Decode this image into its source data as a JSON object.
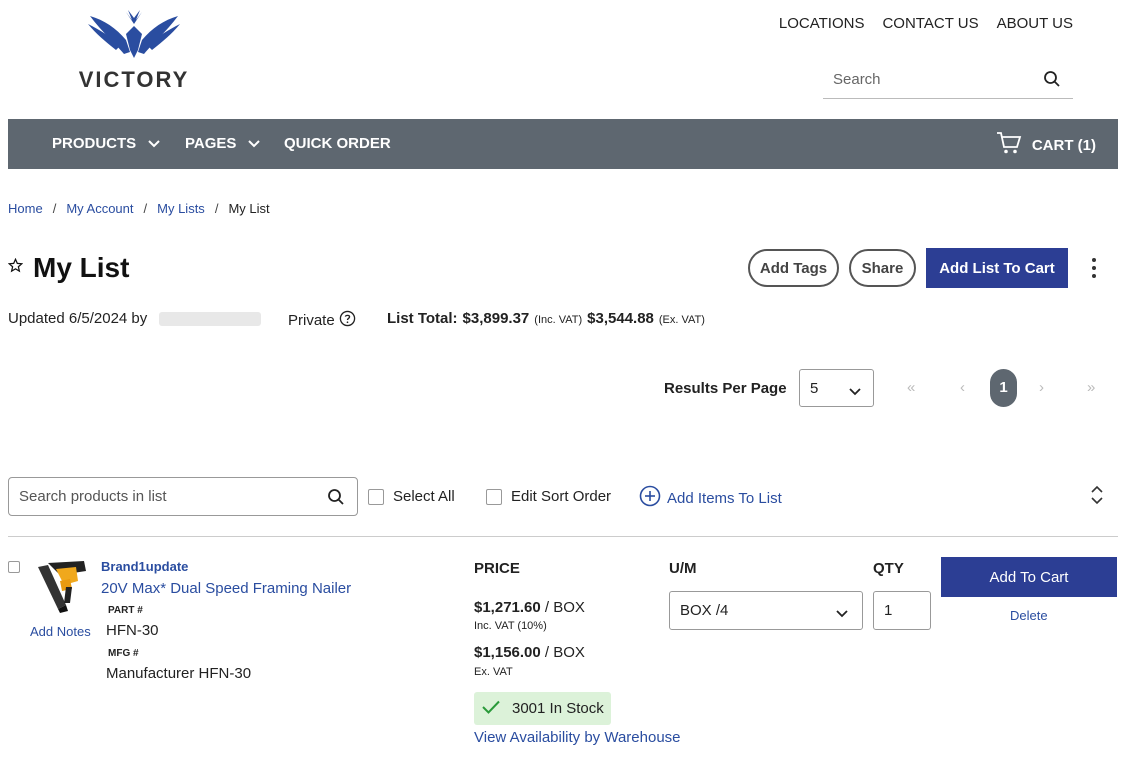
{
  "brand": {
    "logo_text": "VICTORY",
    "accent": "#2a4da0"
  },
  "top_links": [
    "LOCATIONS",
    "CONTACT US",
    "ABOUT US"
  ],
  "header_search": {
    "placeholder": "Search"
  },
  "nav": {
    "items": [
      "PRODUCTS",
      "PAGES",
      "QUICK ORDER"
    ],
    "cart_label": "CART (1)",
    "bg_color": "#5e6770"
  },
  "breadcrumb": {
    "links": [
      "Home",
      "My Account",
      "My Lists"
    ],
    "separator": "/",
    "current": "My List"
  },
  "page": {
    "title": "My List",
    "buttons": {
      "add_tags": "Add Tags",
      "share": "Share",
      "add_list_to_cart": "Add List To Cart"
    },
    "updated": "Updated 6/5/2024 by",
    "privacy": "Private",
    "list_total_label": "List Total:",
    "total_inc": "$3,899.37",
    "inc_note": "(Inc. VAT)",
    "total_ex": "$3,544.88",
    "ex_note": "(Ex. VAT)"
  },
  "pagination": {
    "results_label": "Results Per Page",
    "per_page": "5",
    "first": "«",
    "prev": "‹",
    "current_page": "1",
    "next": "›",
    "last": "»"
  },
  "toolbar": {
    "search_placeholder": "Search products in list",
    "select_all": "Select All",
    "edit_sort": "Edit Sort Order",
    "add_items": "Add Items To List"
  },
  "columns": {
    "price": "PRICE",
    "um": "U/M",
    "qty": "QTY"
  },
  "item": {
    "add_notes": "Add Notes",
    "brand": "Brand1update",
    "name": "20V Max* Dual Speed Framing Nailer",
    "part_label": "PART #",
    "part_value": "HFN-30",
    "mfg_label": "MFG #",
    "mfg_value": "Manufacturer HFN-30",
    "price_inc": "$1,271.60",
    "price_inc_unit": "/ BOX",
    "price_inc_note": "Inc. VAT (10%)",
    "price_ex": "$1,156.00",
    "price_ex_unit": "/ BOX",
    "price_ex_note": "Ex. VAT",
    "stock": "3001 In Stock",
    "warehouse_link": "View Availability by Warehouse",
    "um": "BOX /4",
    "qty": "1",
    "add_to_cart": "Add To Cart",
    "delete": "Delete"
  }
}
